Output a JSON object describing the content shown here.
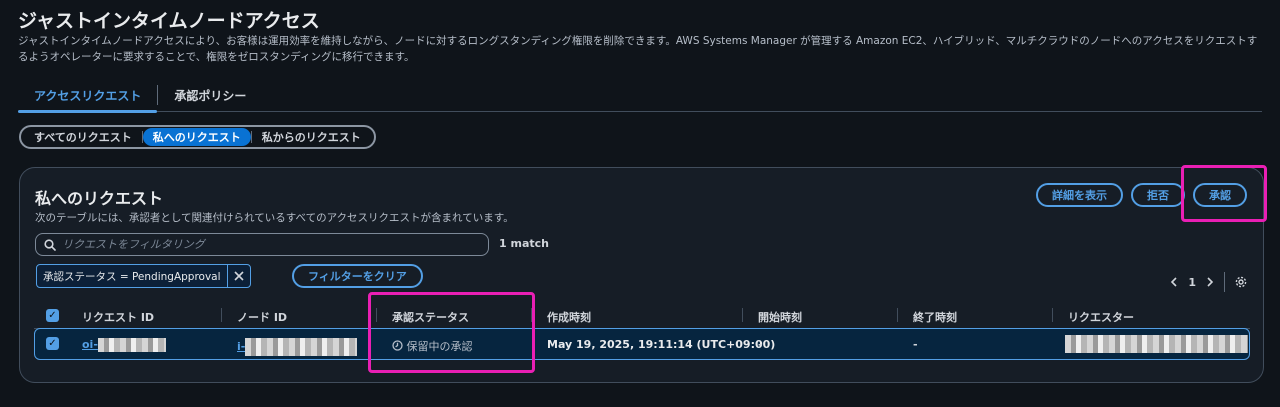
{
  "page": {
    "title": "ジャストインタイムノードアクセス",
    "description": "ジャストインタイムノードアクセスにより、お客様は運用効率を維持しながら、ノードに対するロングスタンディング権限を削除できます。AWS Systems Manager が管理する Amazon EC2、ハイブリッド、マルチクラウドのノードへのアクセスをリクエストするようオペレーターに要求することで、権限をゼロスタンディングに移行できます。"
  },
  "tabs": [
    {
      "label": "アクセスリクエスト",
      "active": true
    },
    {
      "label": "承認ポリシー",
      "active": false
    }
  ],
  "filters": [
    {
      "label": "すべてのリクエスト",
      "active": false
    },
    {
      "label": "私へのリクエスト",
      "active": true
    },
    {
      "label": "私からのリクエスト",
      "active": false
    }
  ],
  "panel": {
    "title": "私へのリクエスト",
    "description": "次のテーブルには、承認者として関連付けられているすべてのアクセスリクエストが含まれています。",
    "actions": {
      "details": "詳細を表示",
      "reject": "拒否",
      "approve": "承認"
    },
    "search_placeholder": "リクエストをフィルタリング",
    "match_text": "1 match",
    "filter_token": "承認ステータス = PendingApproval",
    "clear_filter": "フィルターをクリア",
    "page_number": "1"
  },
  "table": {
    "columns": [
      "リクエスト ID",
      "ノード ID",
      "承認ステータス",
      "作成時刻",
      "開始時刻",
      "終了時刻",
      "リクエスター"
    ],
    "rows": [
      {
        "request_id_prefix": "oi-",
        "node_id_prefix": "i-",
        "status": "保留中の承認",
        "created": "May 19, 2025, 19:11:14 (UTC+09:00)",
        "start": "-",
        "end": "-"
      }
    ]
  },
  "colors": {
    "accent": "#539fe5",
    "highlight": "#e91fb4",
    "background": "#0f141a"
  }
}
